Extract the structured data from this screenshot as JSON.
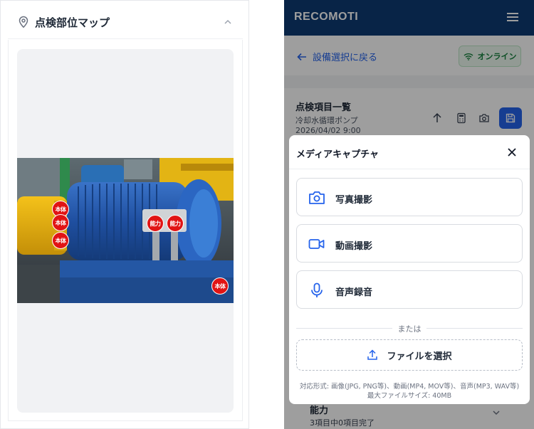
{
  "left_panel": {
    "title": "点検部位マップ",
    "markers": [
      {
        "label": "本体"
      },
      {
        "label": "本体"
      },
      {
        "label": "本体"
      },
      {
        "label": "能力"
      },
      {
        "label": "能力"
      },
      {
        "label": "本体"
      }
    ]
  },
  "app": {
    "brand": "RECOMOTI",
    "back_label": "設備選択に戻る",
    "status": "オンライン",
    "list": {
      "title": "点検項目一覧",
      "subtitle": "冷却水循環ポンプ",
      "date": "2026/04/02 9:00"
    },
    "section": {
      "title": "能力",
      "progress": "3項目中0項目完了"
    }
  },
  "modal": {
    "title": "メディアキャプチャ",
    "options": [
      {
        "label": "写真撮影",
        "icon": "camera-icon"
      },
      {
        "label": "動画撮影",
        "icon": "video-icon"
      },
      {
        "label": "音声録音",
        "icon": "microphone-icon"
      }
    ],
    "divider": "または",
    "file_button": "ファイルを選択",
    "hint_formats": "対応形式: 画像(JPG, PNG等)、動画(MP4, MOV等)、音声(MP3, WAV等)",
    "hint_size": "最大ファイルサイズ: 40MB"
  },
  "colors": {
    "brand_bar": "#0d3b73",
    "accent": "#2563eb",
    "marker": "#e11414",
    "online": "#15803d"
  }
}
